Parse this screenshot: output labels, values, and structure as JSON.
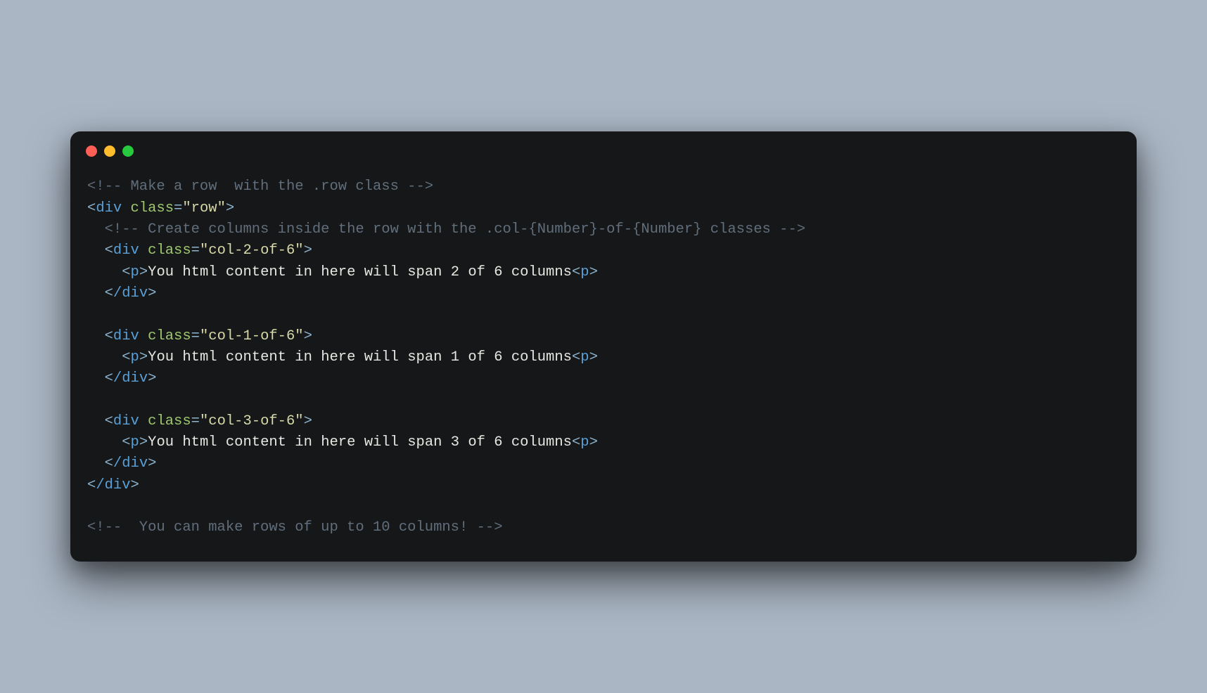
{
  "code": {
    "comment1": "<!-- Make a row  with the .row class -->",
    "comment2": "<!-- Create columns inside the row with the .col-{Number}-of-{Number} classes -->",
    "comment3": "<!--  You can make rows of up to 10 columns! -->",
    "tags": {
      "div": "div",
      "divClose": "/div",
      "p": "p"
    },
    "attrs": {
      "class": "class"
    },
    "strings": {
      "row": "\"row\"",
      "col2": "\"col-2-of-6\"",
      "col1": "\"col-1-of-6\"",
      "col3": "\"col-3-of-6\""
    },
    "texts": {
      "t2": "You html content in here will span 2 of 6 columns",
      "t1": "You html content in here will span 1 of 6 columns",
      "t3": "You html content in here will span 3 of 6 columns"
    },
    "punct": {
      "lt": "<",
      "gt": ">",
      "eq": "="
    }
  },
  "indent": {
    "i1": "  ",
    "i2": "    "
  }
}
